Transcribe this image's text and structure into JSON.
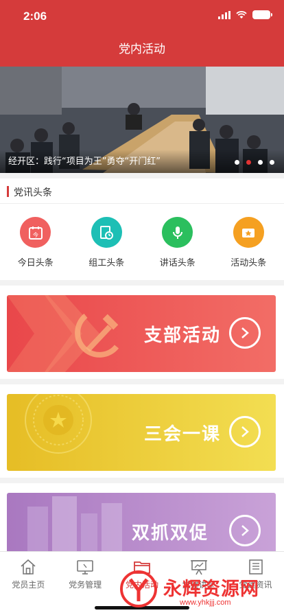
{
  "status": {
    "time": "2:06"
  },
  "nav": {
    "title": "党内活动"
  },
  "banner": {
    "caption": "经开区：践行“项目为王”勇夺“开门红”",
    "dots": 4,
    "active_dot": 1
  },
  "news": {
    "title": "党讯头条",
    "items": [
      {
        "label": "今日头条",
        "icon": "calendar-icon",
        "color": "#f0605f"
      },
      {
        "label": "组工头条",
        "icon": "document-clock-icon",
        "color": "#1dbfb5"
      },
      {
        "label": "讲话头条",
        "icon": "microphone-icon",
        "color": "#2bbf5e"
      },
      {
        "label": "活动头条",
        "icon": "star-ticket-icon",
        "color": "#f5a021"
      }
    ]
  },
  "cards": [
    {
      "label": "支部活动",
      "colors": [
        "#e9474a",
        "#f16a64"
      ]
    },
    {
      "label": "三会一课",
      "colors": [
        "#e8c22a",
        "#f2dc4c"
      ]
    },
    {
      "label": "双抓双促",
      "colors": [
        "#b07cc4",
        "#c79bd5"
      ]
    }
  ],
  "tabs": [
    {
      "label": "党员主页",
      "icon": "home-icon"
    },
    {
      "label": "党务管理",
      "icon": "monitor-icon"
    },
    {
      "label": "党内活动",
      "icon": "folder-icon",
      "active": true
    },
    {
      "label": "党建讲堂",
      "icon": "presentation-icon"
    },
    {
      "label": "党建资讯",
      "icon": "newspaper-icon"
    }
  ],
  "watermark": {
    "text": "永辉资源网",
    "url": "www.yhkjjj.com"
  }
}
